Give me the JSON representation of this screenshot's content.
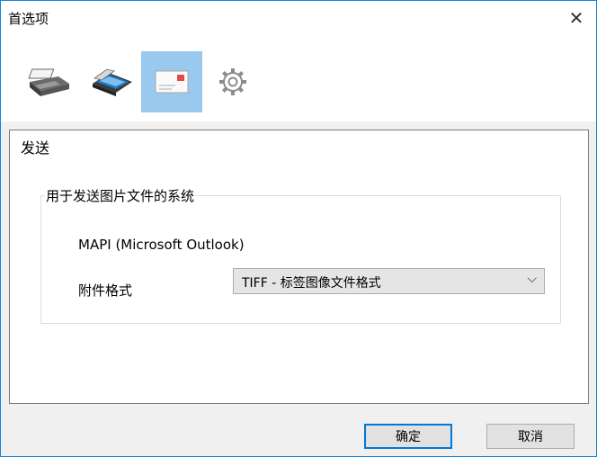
{
  "window": {
    "title": "首选项",
    "close_symbol": "✕"
  },
  "toolbar": {
    "items": [
      {
        "name": "printer",
        "icon": "printer-icon",
        "active": false
      },
      {
        "name": "scanner",
        "icon": "scanner-icon",
        "active": false
      },
      {
        "name": "send",
        "icon": "envelope-icon",
        "active": true
      },
      {
        "name": "settings",
        "icon": "gear-icon",
        "active": false
      }
    ]
  },
  "panel": {
    "title": "发送",
    "group": {
      "legend": "用于发送图片文件的系统",
      "mapi_label": "MAPI (Microsoft Outlook)",
      "attachment_label": "附件格式",
      "attachment_format": {
        "selected": "TIFF - 标签图像文件格式",
        "arrow": "⌵"
      }
    }
  },
  "buttons": {
    "ok": "确定",
    "cancel": "取消"
  },
  "colors": {
    "active_tab": "#99c9ef",
    "focus_border": "#0078d7",
    "window_border": "#1883d7"
  }
}
